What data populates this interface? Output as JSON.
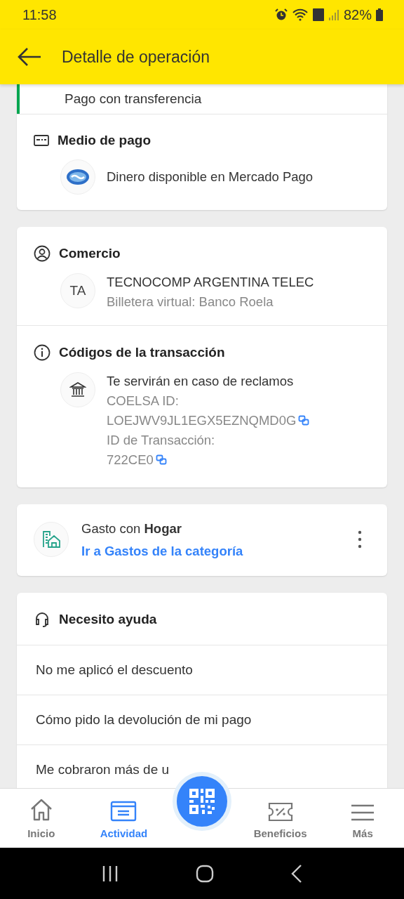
{
  "status_bar": {
    "time": "11:58",
    "battery": "82%"
  },
  "header": {
    "title": "Detalle de operación"
  },
  "payment_card": {
    "method_row": "Pago con transferencia",
    "section_title": "Medio de pago",
    "source": "Dinero disponible en Mercado Pago"
  },
  "merchant_card": {
    "section_title": "Comercio",
    "initials": "TA",
    "name": "TECNOCOMP ARGENTINA TELEC",
    "subtitle": "Billetera virtual: Banco Roela",
    "codes_title": "Códigos de la transacción",
    "codes_intro": "Te servirán en caso de reclamos",
    "codes": [
      {
        "label": "COELSA ID:",
        "value": "LOEJWV9JL1EGX5EZNQMD0G"
      },
      {
        "label": "ID de Transacción:",
        "value": "722CE0"
      }
    ]
  },
  "category_card": {
    "text": "Gasto con **Hogar**",
    "link": "Ir a Gastos de la categoría"
  },
  "help_card": {
    "title": "Necesito ayuda",
    "items": [
      "No me aplicó el descuento",
      "Cómo pido la devolución de mi pago",
      "Me cobraron más de u"
    ]
  },
  "bottom_nav": [
    {
      "kind": "home",
      "label": "Inicio",
      "selected": false
    },
    {
      "kind": "activity",
      "label": "Actividad",
      "selected": true
    },
    {
      "kind": "qr"
    },
    {
      "kind": "benefits",
      "label": "Beneficios",
      "selected": false
    },
    {
      "kind": "more",
      "label": "Más",
      "selected": false
    }
  ]
}
